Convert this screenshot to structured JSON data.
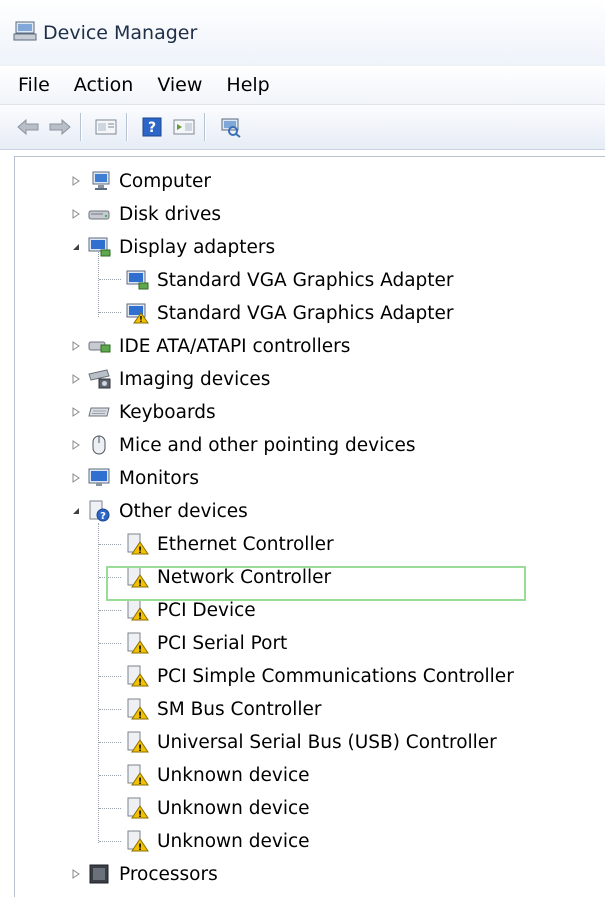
{
  "window": {
    "title": "Device Manager",
    "icon": "device-manager-icon"
  },
  "menu": {
    "file": "File",
    "action": "Action",
    "view": "View",
    "help": "Help"
  },
  "toolbar": {
    "buttons": [
      "back-arrow-icon",
      "forward-arrow-icon",
      "properties-pane-icon",
      "help-icon",
      "action-pane-icon",
      "scan-hardware-icon"
    ]
  },
  "tree": {
    "computer": "Computer",
    "disk_drives": "Disk drives",
    "display_adapters": "Display adapters",
    "vga_1": "Standard VGA Graphics Adapter",
    "vga_2": "Standard VGA Graphics Adapter",
    "ide": "IDE ATA/ATAPI controllers",
    "imaging": "Imaging devices",
    "keyboards": "Keyboards",
    "mice": "Mice and other pointing devices",
    "monitors": "Monitors",
    "other_devices": "Other devices",
    "ethernet": "Ethernet Controller",
    "network": "Network Controller",
    "pci_device": "PCI Device",
    "pci_serial": "PCI Serial Port",
    "pci_simple": "PCI Simple Communications Controller",
    "sm_bus": "SM Bus Controller",
    "usb": "Universal Serial Bus (USB) Controller",
    "unknown_1": "Unknown device",
    "unknown_2": "Unknown device",
    "unknown_3": "Unknown device",
    "processors": "Processors"
  },
  "colors": {
    "highlight": "#98dc98",
    "warning": "#f2c200",
    "accent": "#1f5fbf"
  }
}
